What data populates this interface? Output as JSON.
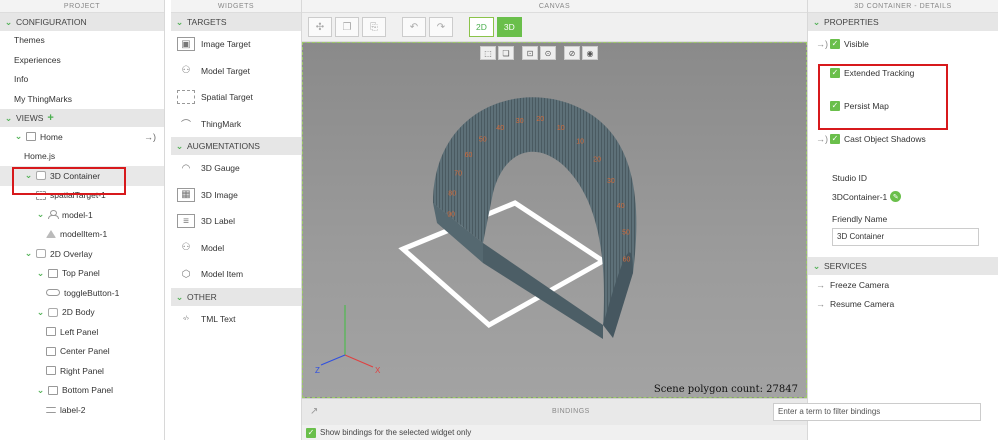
{
  "project": {
    "title": "PROJECT",
    "configuration": "CONFIGURATION",
    "config_items": [
      "Themes",
      "Experiences",
      "Info",
      "My ThingMarks"
    ],
    "views": "VIEWS",
    "tree": [
      {
        "label": "Home",
        "level": 1
      },
      {
        "label": "Home.js",
        "level": 1
      },
      {
        "label": "3D Container",
        "level": 2
      },
      {
        "label": "spatialTarget-1",
        "level": 3
      },
      {
        "label": "model-1",
        "level": 3
      },
      {
        "label": "modelItem-1",
        "level": 4
      },
      {
        "label": "2D Overlay",
        "level": 2
      },
      {
        "label": "Top Panel",
        "level": 3
      },
      {
        "label": "toggleButton-1",
        "level": 4
      },
      {
        "label": "2D Body",
        "level": 3
      },
      {
        "label": "Left Panel",
        "level": 4
      },
      {
        "label": "Center Panel",
        "level": 4
      },
      {
        "label": "Right Panel",
        "level": 4
      },
      {
        "label": "Bottom Panel",
        "level": 3
      },
      {
        "label": "label-2",
        "level": 4
      }
    ]
  },
  "widgets": {
    "title": "WIDGETS",
    "targets": "TARGETS",
    "target_items": [
      "Image Target",
      "Model Target",
      "Spatial Target",
      "ThingMark"
    ],
    "augmentations": "AUGMENTATIONS",
    "aug_items": [
      "3D Gauge",
      "3D Image",
      "3D Label",
      "Model",
      "Model Item"
    ],
    "other": "OTHER",
    "other_items": [
      "TML Text"
    ]
  },
  "canvas": {
    "title": "CANVAS",
    "mode_2d": "2D",
    "mode_3d": "3D",
    "polygon_count": "Scene polygon count: 27847",
    "axis_z": "Z",
    "axis_x": "X",
    "protractor_numbers": [
      "90",
      "80",
      "70",
      "60",
      "50",
      "40",
      "30",
      "20",
      "10",
      "10",
      "20",
      "30",
      "40",
      "50",
      "60"
    ],
    "bindings": "BINDINGS",
    "show_bindings": "Show bindings for the selected widget only",
    "filter_placeholder": "Enter a term to filter bindings"
  },
  "details": {
    "title": "3D CONTAINER - DETAILS",
    "properties": "PROPERTIES",
    "visible": "Visible",
    "extended_tracking": "Extended Tracking",
    "persist_map": "Persist Map",
    "cast_shadows": "Cast Object Shadows",
    "studio_id_label": "Studio ID",
    "studio_id": "3DContainer-1",
    "friendly_name_label": "Friendly Name",
    "friendly_name": "3D Container",
    "services": "SERVICES",
    "service_items": [
      "Freeze Camera",
      "Resume Camera"
    ]
  },
  "colors": {
    "accent": "#6abf4b",
    "highlight": "#d7191c"
  }
}
